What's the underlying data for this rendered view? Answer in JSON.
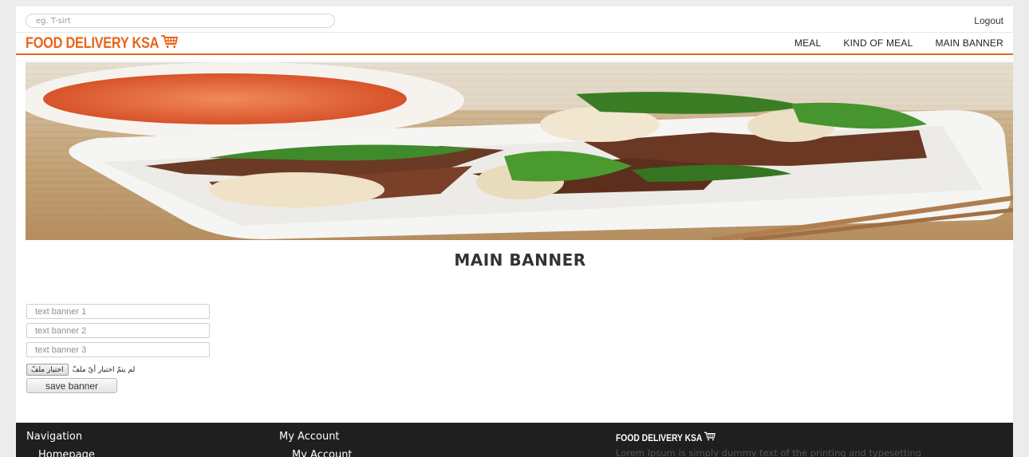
{
  "header": {
    "search_placeholder": "eg. T-sirt",
    "logout": "Logout",
    "brand": "FOOD DELIVERY KSA",
    "nav": [
      "MEAL",
      "KIND OF MEAL",
      "MAIN BANNER"
    ],
    "accent_color": "#e8641a"
  },
  "main": {
    "title": "MAIN BANNER",
    "banner_image": "food-banner-image",
    "fields": [
      {
        "placeholder": "text banner 1"
      },
      {
        "placeholder": "text banner 2"
      },
      {
        "placeholder": "text banner 3"
      }
    ],
    "file_button": "اختيار ملفّ",
    "file_status": "لم يتمّ اختيار أيّ ملفّ",
    "save_label": "save banner"
  },
  "footer": {
    "col1_title": "Navigation",
    "col1_item": "Homepage",
    "col2_title": "My Account",
    "col2_item": "My Account",
    "brand": "FOOD DELIVERY KSA",
    "description": "Lorem Ipsum is simply dummy text of the printing and typesetting"
  }
}
